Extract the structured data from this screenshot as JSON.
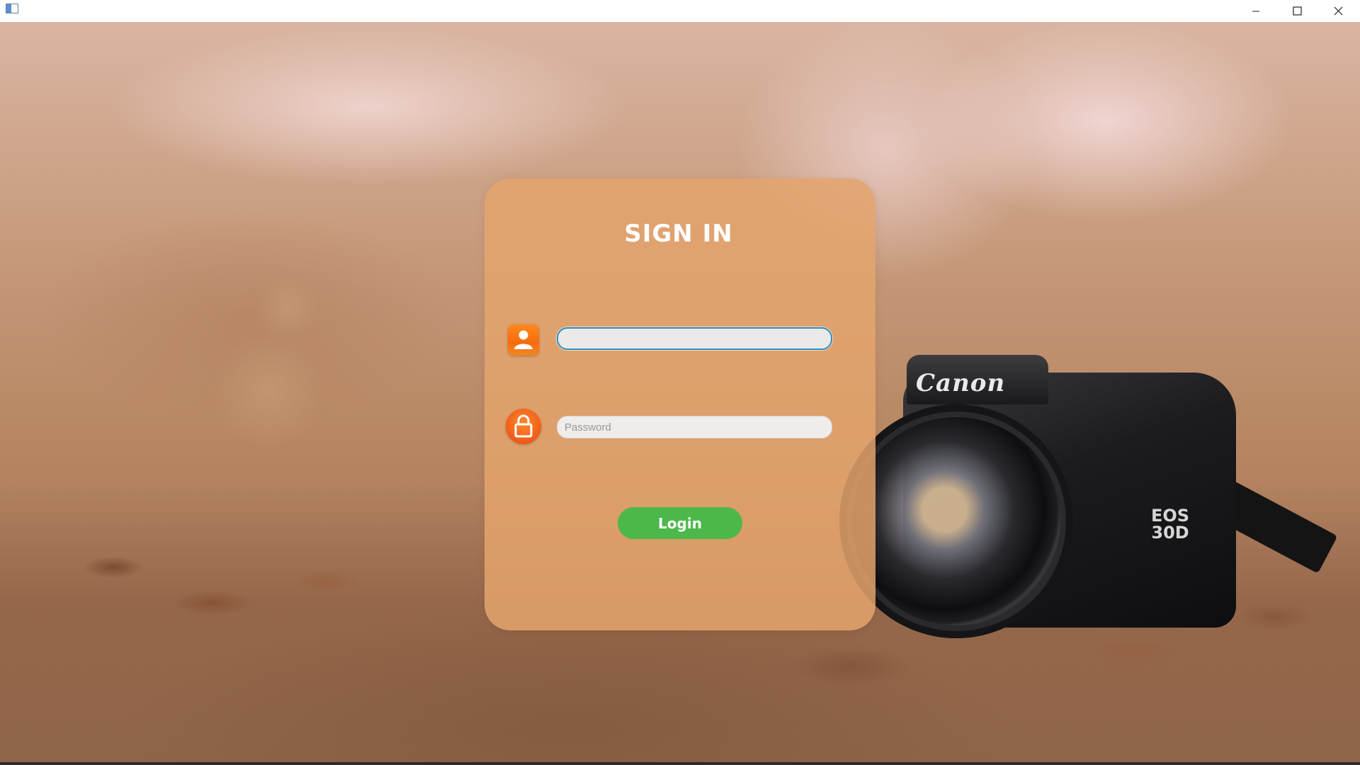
{
  "window": {
    "app_icon": "window-app-icon",
    "controls": [
      "minimize-icon",
      "maximize-icon",
      "close-icon"
    ]
  },
  "background": {
    "camera_brand": "Canon",
    "camera_model_line1": "EOS",
    "camera_model_line2": "30D"
  },
  "login_card": {
    "title": "SIGN IN",
    "username": {
      "icon": "user-icon",
      "value": "",
      "placeholder": ""
    },
    "password": {
      "icon": "lock-icon",
      "value": "",
      "placeholder": "Password"
    },
    "login_label": "Login"
  },
  "colors": {
    "card": "#e4a36c",
    "login_button": "#4cb84a",
    "icon_accent": "#f76a0c",
    "focus_border": "#2f8ec2"
  }
}
